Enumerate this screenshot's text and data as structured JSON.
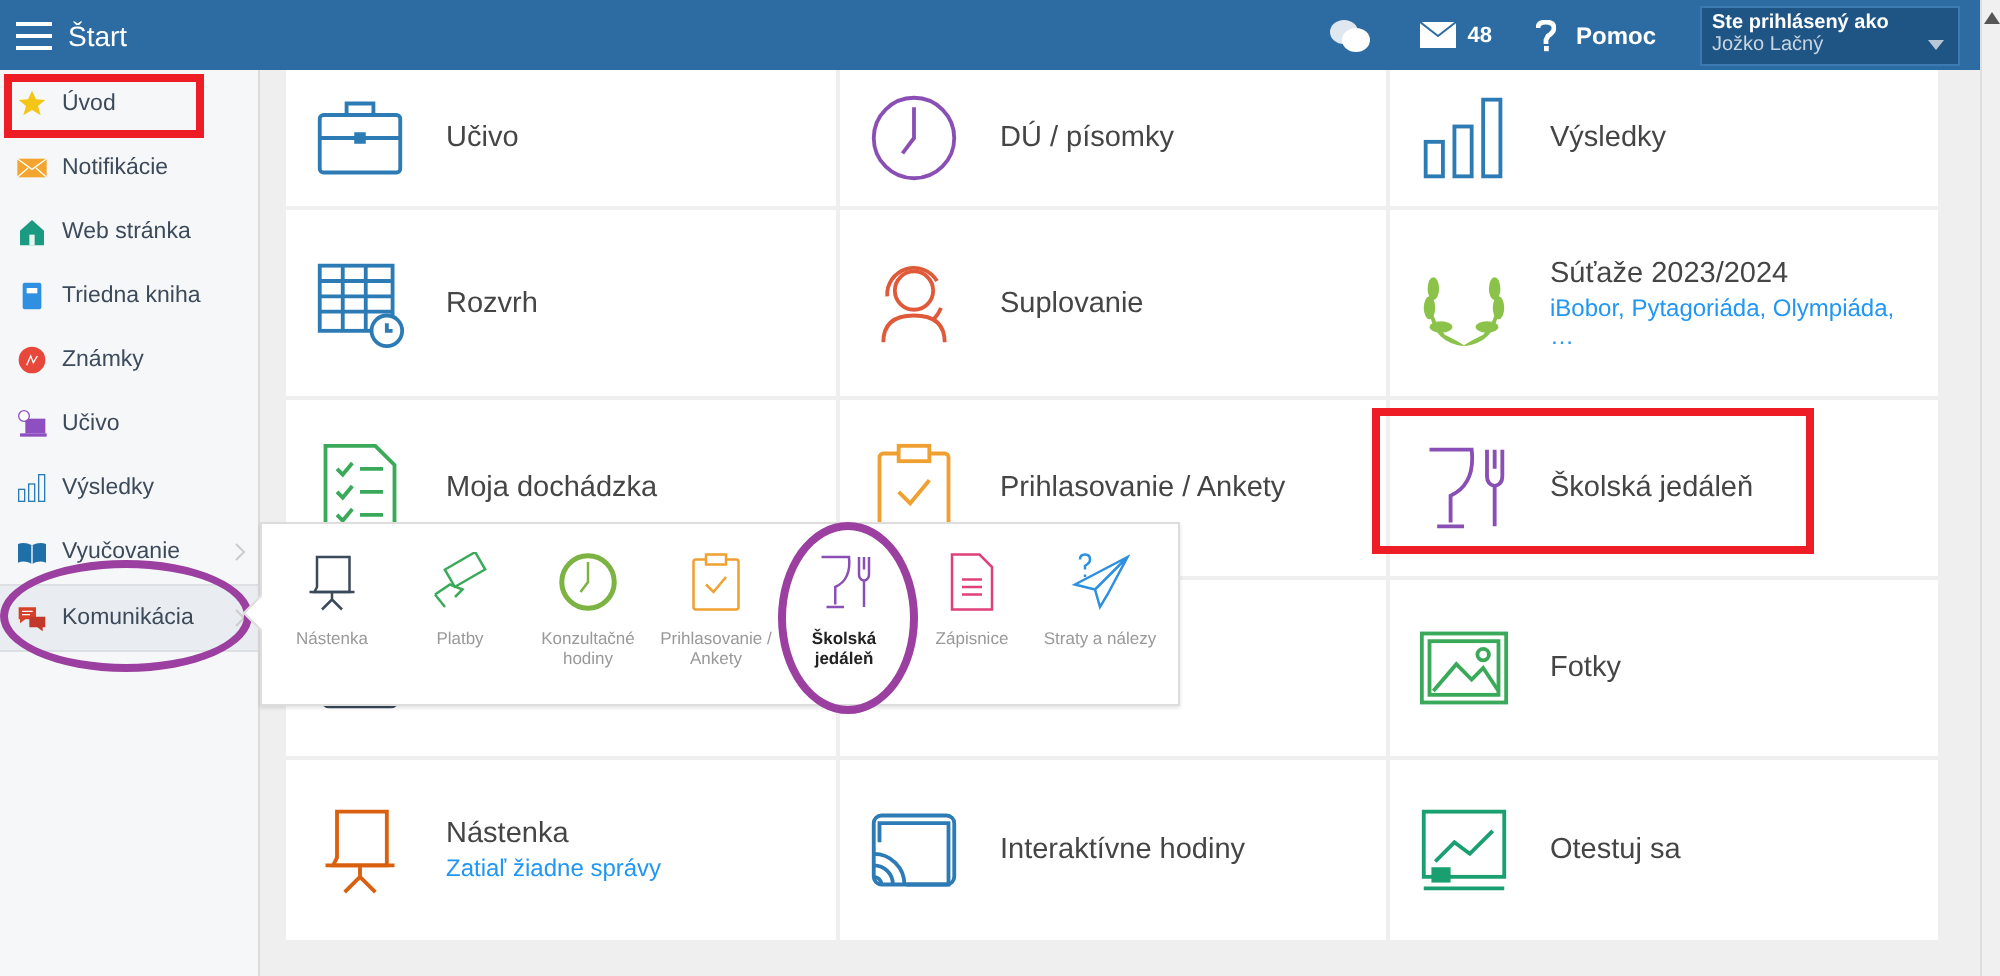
{
  "header": {
    "title": "Štart",
    "message_count": "48",
    "help": "Pomoc",
    "user_label": "Ste prihlásený ako",
    "user_name": "Jožko Lačný"
  },
  "sidebar": {
    "items": [
      {
        "label": "Úvod",
        "kind": "star",
        "selected": false,
        "submenu": false,
        "boxed": true,
        "circled": false
      },
      {
        "label": "Notifikácie",
        "kind": "envelope",
        "selected": false,
        "submenu": false,
        "boxed": false,
        "circled": false
      },
      {
        "label": "Web stránka",
        "kind": "house",
        "selected": false,
        "submenu": false,
        "boxed": false,
        "circled": false
      },
      {
        "label": "Triedna kniha",
        "kind": "book",
        "selected": false,
        "submenu": false,
        "boxed": false,
        "circled": false
      },
      {
        "label": "Známky",
        "kind": "grade",
        "selected": false,
        "submenu": false,
        "boxed": false,
        "circled": false
      },
      {
        "label": "Učivo",
        "kind": "laptop",
        "selected": false,
        "submenu": false,
        "boxed": false,
        "circled": false
      },
      {
        "label": "Výsledky",
        "kind": "bars",
        "selected": false,
        "submenu": false,
        "boxed": false,
        "circled": false
      },
      {
        "label": "Vyučovanie",
        "kind": "openbook",
        "selected": false,
        "submenu": true,
        "boxed": false,
        "circled": false
      },
      {
        "label": "Komunikácia",
        "kind": "chat",
        "selected": true,
        "submenu": true,
        "boxed": false,
        "circled": true
      }
    ]
  },
  "tiles": [
    {
      "title": "Učivo",
      "kind": "briefcase",
      "boxed": false
    },
    {
      "title": "DÚ / písomky",
      "kind": "clock",
      "boxed": false
    },
    {
      "title": "Výsledky",
      "kind": "bars",
      "boxed": false
    },
    {
      "title": "Rozvrh",
      "kind": "timetable",
      "boxed": false
    },
    {
      "title": "Suplovanie",
      "kind": "person",
      "boxed": false
    },
    {
      "title": "Súťaže 2023/2024",
      "subtitle": "iBobor, Pytagoriáda, Olympiáda, …",
      "kind": "laurel",
      "boxed": false
    },
    {
      "title": "Moja dochádzka",
      "kind": "checklist",
      "boxed": false
    },
    {
      "title": "Prihlasovanie / Ankety",
      "kind": "clipboard",
      "boxed": false
    },
    {
      "title": "Školská jedáleň",
      "kind": "cutlery",
      "boxed": true
    },
    {
      "kind": "board",
      "boxed": false
    },
    {
      "kind": "none",
      "boxed": false
    },
    {
      "title": "Fotky",
      "kind": "photo",
      "boxed": false
    },
    {
      "title": "Nástenka",
      "subtitle": "Zatiaľ žiadne správy",
      "kind": "flipchart",
      "boxed": false
    },
    {
      "title": "Interaktívne hodiny",
      "kind": "cast",
      "boxed": false
    },
    {
      "title": "Otestuj sa",
      "kind": "presentation",
      "boxed": false
    }
  ],
  "submenu": {
    "items": [
      {
        "label": "Nástenka",
        "kind": "flipchart",
        "selected": false,
        "circled": false
      },
      {
        "label": "Platby",
        "kind": "money",
        "selected": false,
        "circled": false
      },
      {
        "label": "Konzultačné hodiny",
        "kind": "clock",
        "selected": false,
        "circled": false
      },
      {
        "label": "Prihlasovanie / Ankety",
        "kind": "clipboard",
        "selected": false,
        "circled": false
      },
      {
        "label": "Školská jedáleň",
        "kind": "cutlery",
        "selected": true,
        "circled": true
      },
      {
        "label": "Zápisnice",
        "kind": "document",
        "selected": false,
        "circled": false
      },
      {
        "label": "Straty a nálezy",
        "kind": "plane",
        "selected": false,
        "circled": false
      }
    ]
  }
}
